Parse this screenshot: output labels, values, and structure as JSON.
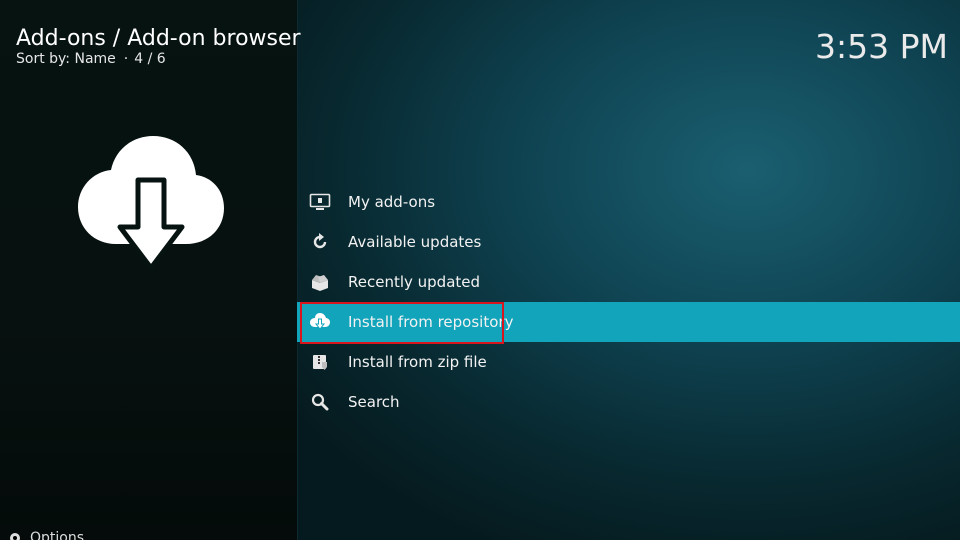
{
  "header": {
    "title": "Add-ons / Add-on browser",
    "sort_label": "Sort by: Name",
    "separator": "·",
    "position": "4 / 6"
  },
  "clock": "3:53 PM",
  "hero_icon": "cloud-download-icon",
  "menu": {
    "items": [
      {
        "label": "My add-ons",
        "icon": "monitor-box-icon"
      },
      {
        "label": "Available updates",
        "icon": "refresh-icon"
      },
      {
        "label": "Recently updated",
        "icon": "open-box-icon"
      },
      {
        "label": "Install from repository",
        "icon": "cloud-download-icon"
      },
      {
        "label": "Install from zip file",
        "icon": "zip-file-icon"
      },
      {
        "label": "Search",
        "icon": "search-icon"
      }
    ],
    "focused_index": 3
  },
  "footer": {
    "options_label": "Options"
  },
  "colors": {
    "focus_bar": "#12a4bb",
    "annotation_box": "#d8141c",
    "left_panel": "#061311",
    "right_panel": "#0f4352"
  }
}
